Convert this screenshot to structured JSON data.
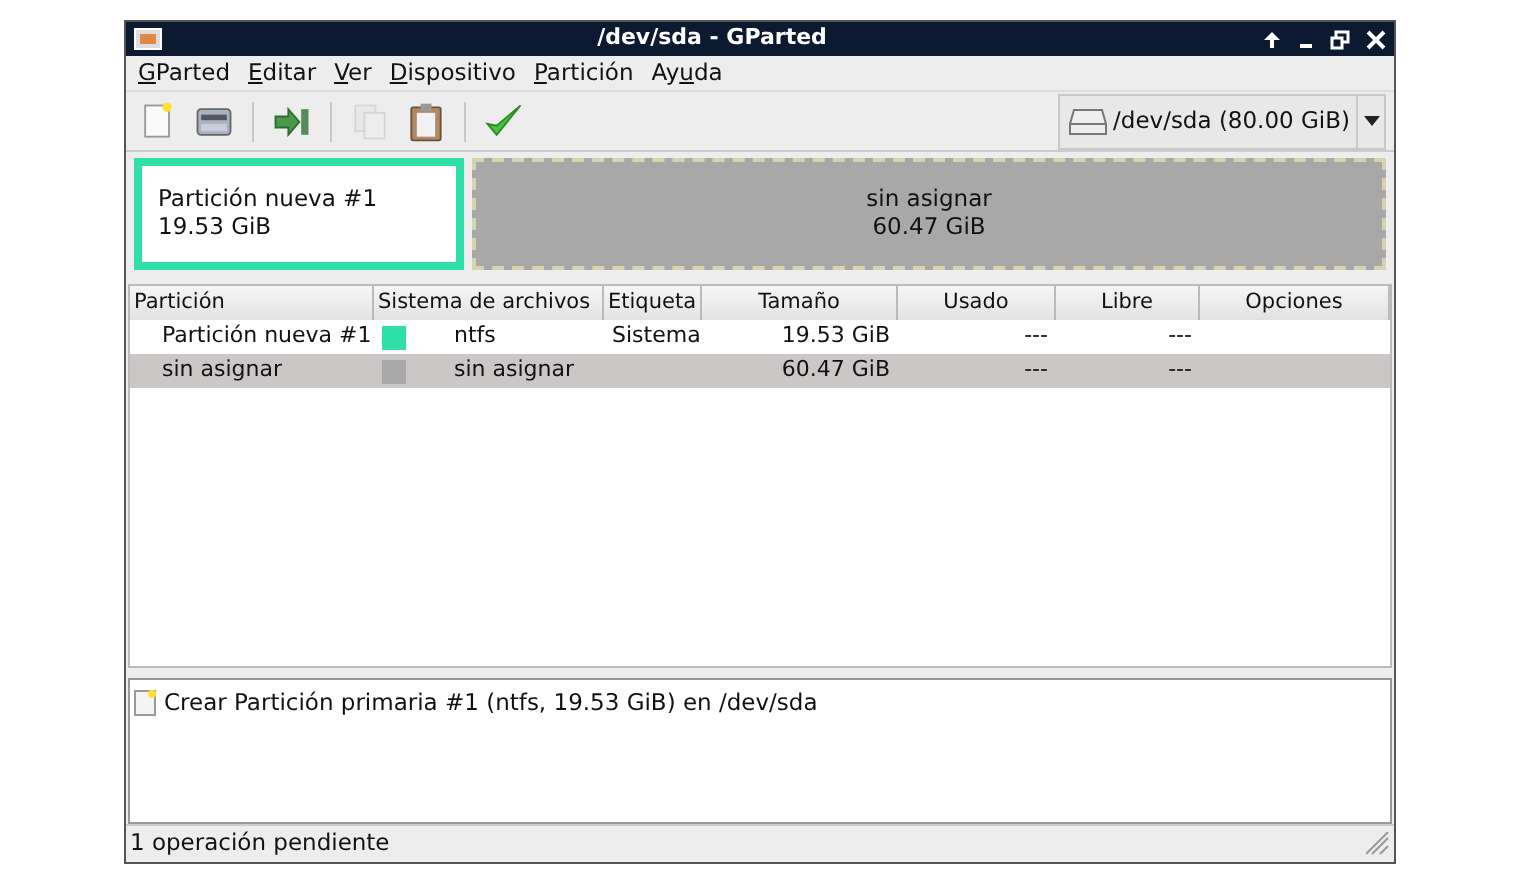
{
  "window": {
    "title": "/dev/sda - GParted"
  },
  "menu": [
    {
      "key": "G",
      "after": "Parted"
    },
    {
      "key": "E",
      "after": "ditar"
    },
    {
      "key": "V",
      "after": "er"
    },
    {
      "key": "D",
      "after": "ispositivo"
    },
    {
      "key": "P",
      "after": "artición"
    },
    {
      "before": "Ay",
      "key": "u",
      "after": "da"
    }
  ],
  "toolbar": [
    {
      "kind": "new",
      "disabled": false
    },
    {
      "kind": "delete",
      "disabled": false
    },
    {
      "kind": "sep"
    },
    {
      "kind": "resize",
      "disabled": false
    },
    {
      "kind": "sep"
    },
    {
      "kind": "copy",
      "disabled": true
    },
    {
      "kind": "paste",
      "disabled": false
    },
    {
      "kind": "sep"
    },
    {
      "kind": "apply",
      "disabled": false
    }
  ],
  "device": {
    "label": "/dev/sda  (80.00 GiB)"
  },
  "disk_map": [
    {
      "kind": "partition",
      "name": "Partición nueva #1",
      "size": "19.53 GiB",
      "color": "#2fdfa8",
      "selected": true,
      "level": 0.244
    },
    {
      "kind": "unallocated",
      "name": "sin asignar",
      "size": "60.47 GiB",
      "color": "#a8a8a8",
      "selected": false,
      "level": 0.756
    }
  ],
  "table": {
    "columns": [
      "Partición",
      "Sistema de archivos",
      "Etiqueta",
      "Tamaño",
      "Usado",
      "Libre",
      "Opciones"
    ],
    "rows": [
      {
        "partition": "Partición nueva #1",
        "color": "#2fdfa8",
        "filesystem": "ntfs",
        "label": "Sistema",
        "size": "19.53 GiB",
        "used": "---",
        "free": "---",
        "selected": false
      },
      {
        "partition": "sin asignar",
        "color": "#a8a8a8",
        "filesystem": "sin asignar",
        "size": "60.47 GiB",
        "used": "---",
        "free": "---",
        "selected": true
      }
    ]
  },
  "operations": [
    {
      "text": "Crear Partición primaria #1 (ntfs, 19.53 GiB) en /dev/sda"
    }
  ],
  "status_bar": "1 operación pendiente"
}
